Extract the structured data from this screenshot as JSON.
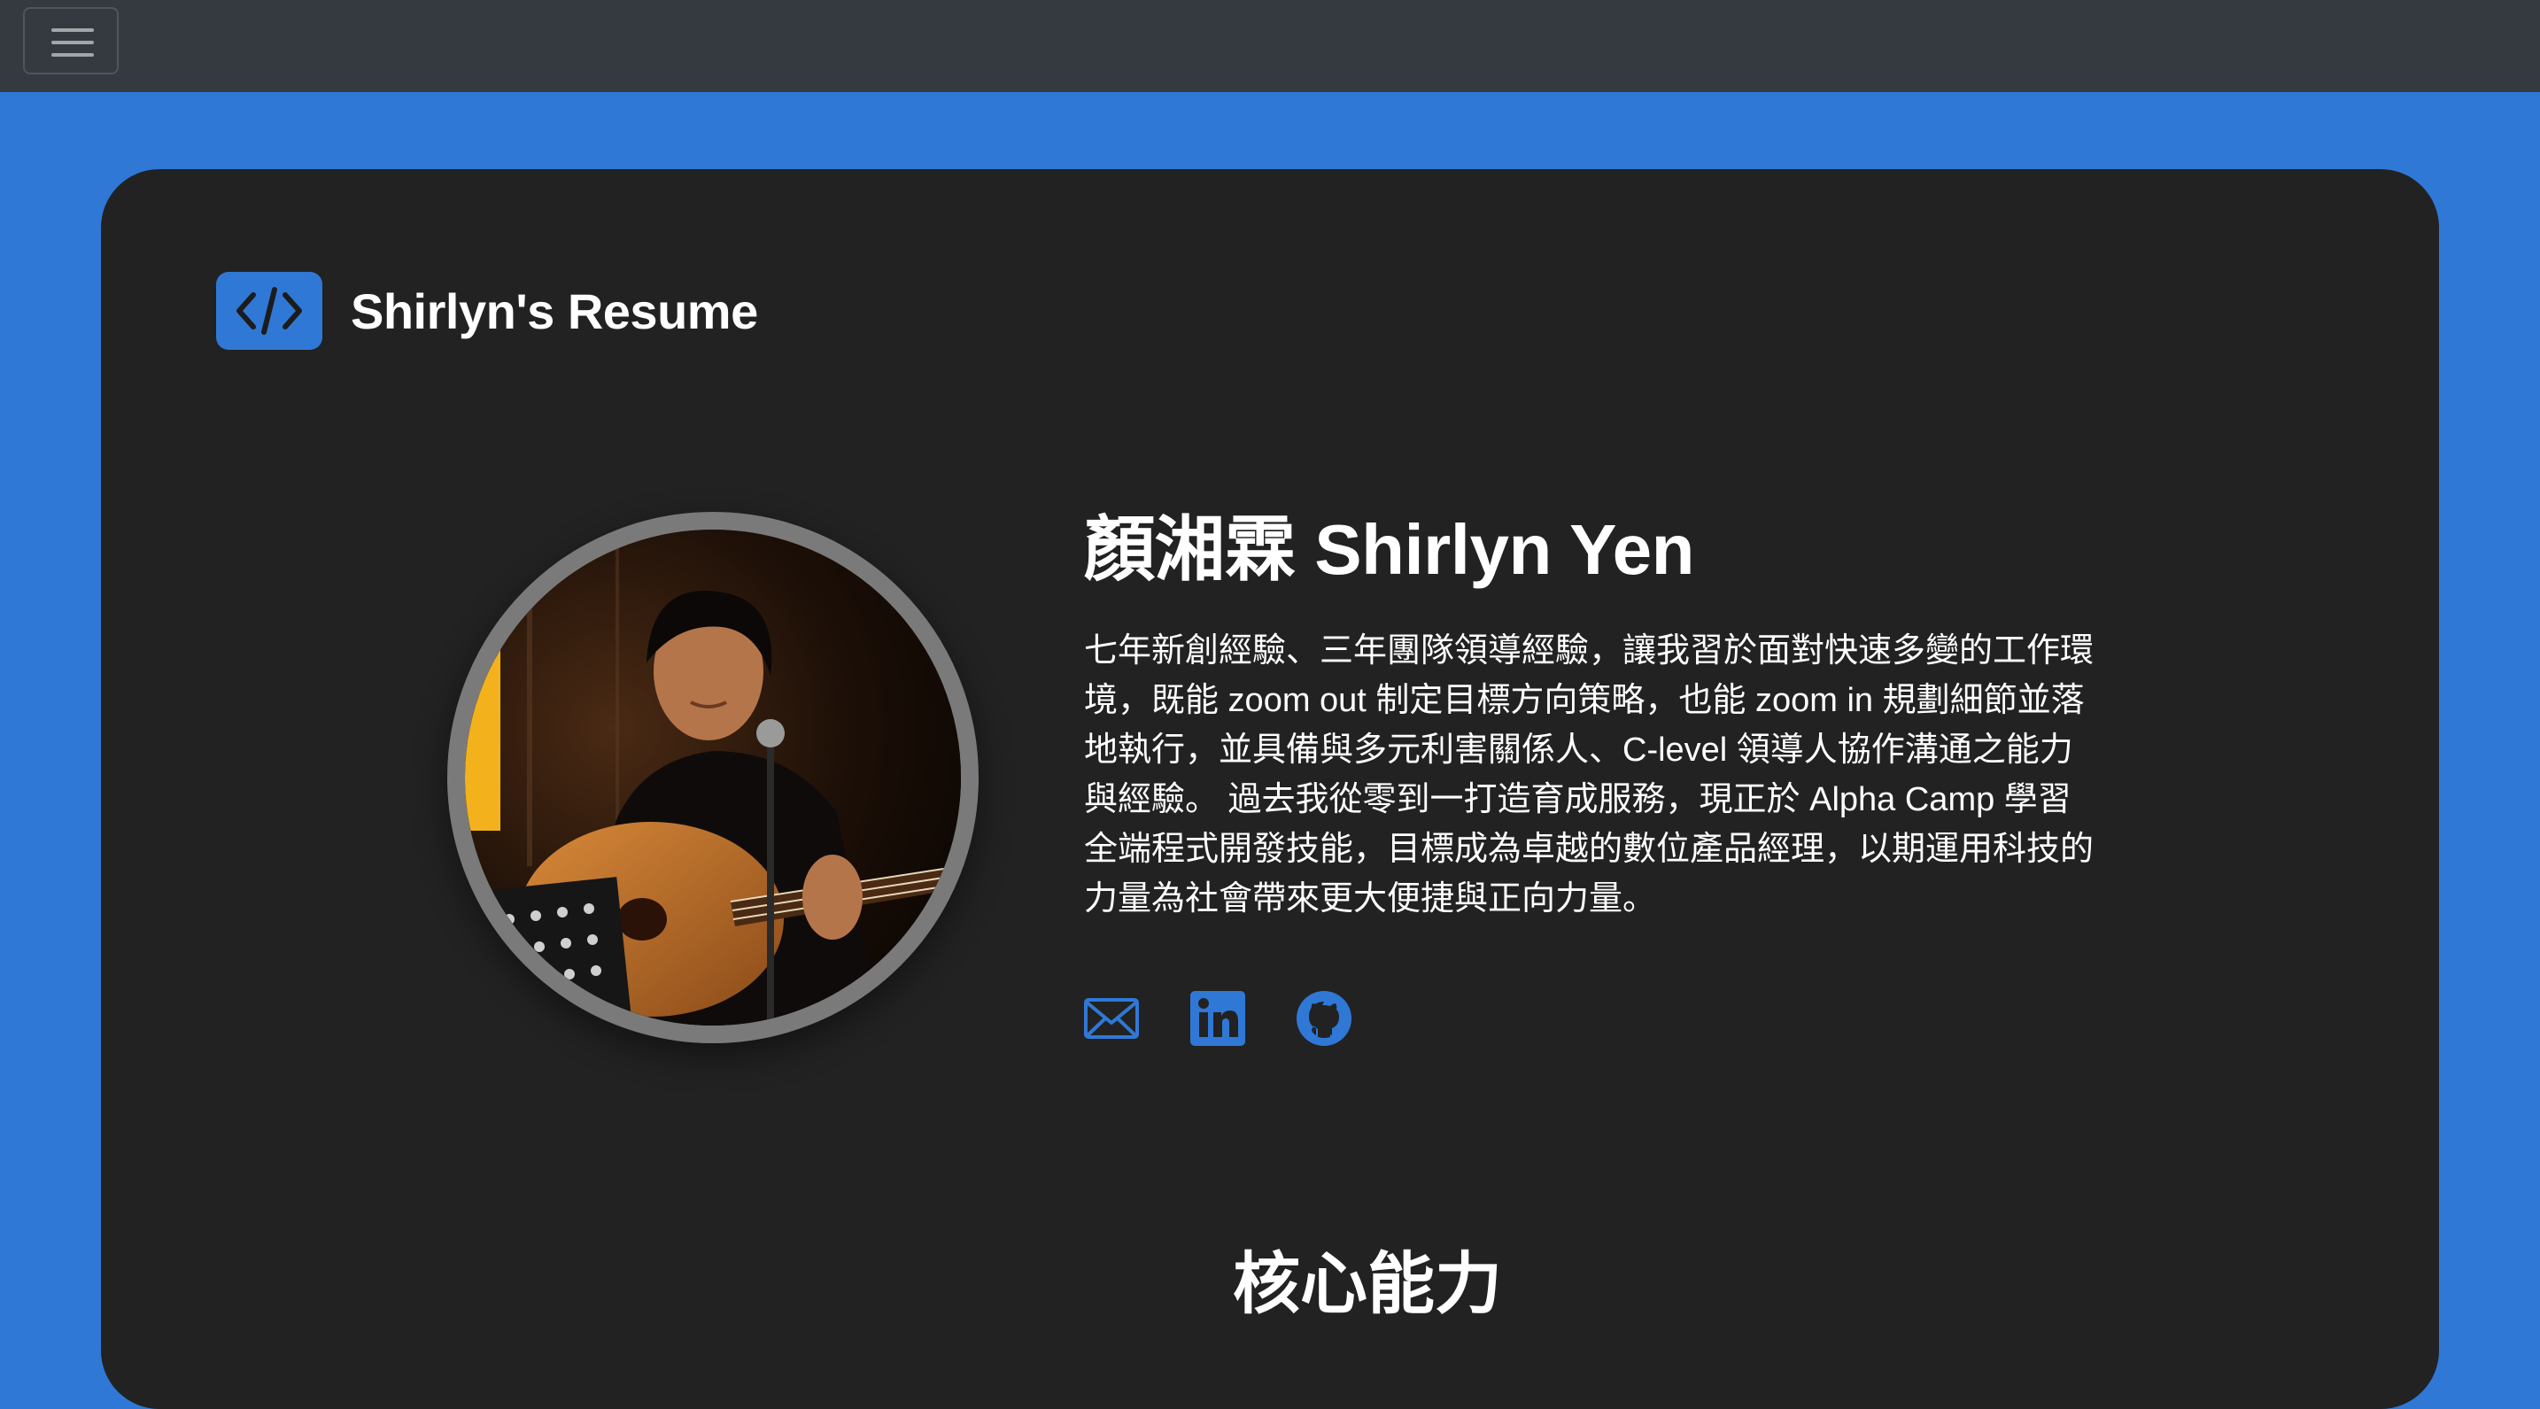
{
  "navbar": {
    "menu_icon": "hamburger-menu-icon",
    "background": "#343a40"
  },
  "brand": {
    "logo_icon": "code-icon",
    "title": "Shirlyn's Resume",
    "accent": "#3078d6"
  },
  "profile": {
    "photo": "profile photo of a woman playing acoustic guitar at a microphone",
    "name": "顏湘霖 Shirlyn Yen",
    "bio": "七年新創經驗、三年團隊領導經驗，讓我習於面對快速多變的工作環境，既能 zoom out 制定目標方向策略，也能 zoom in 規劃細節並落地執行，並具備與多元利害關係人、C-level 領導人協作溝通之能力與經驗。 過去我從零到一打造育成服務，現正於 Alpha Camp 學習全端程式開發技能，目標成為卓越的數位產品經理，以期運用科技的力量為社會帶來更大便捷與正向力量。"
  },
  "social_links": [
    {
      "icon": "email-icon"
    },
    {
      "icon": "linkedin-icon"
    },
    {
      "icon": "github-icon"
    }
  ],
  "sections": {
    "core_skills_title": "核心能力"
  },
  "colors": {
    "page_background": "#3078d6",
    "card_background": "#222222",
    "text": "#ffffff",
    "icon_blue": "#3078d6"
  }
}
